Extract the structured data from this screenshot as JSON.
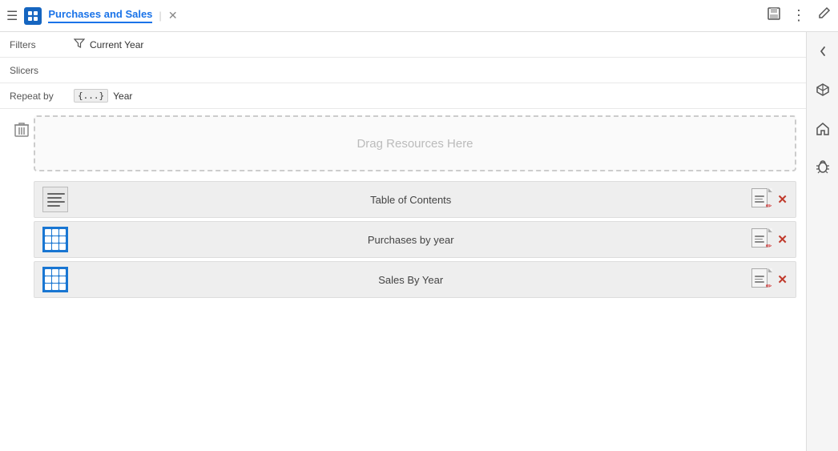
{
  "topbar": {
    "hamburger_label": "☰",
    "app_icon_label": "📊",
    "tab_title": "Purchases and Sales",
    "tab_separator": "|",
    "close_label": "✕",
    "save_icon": "💾",
    "more_icon": "⋮",
    "edit_icon": "✏"
  },
  "config": {
    "filters_label": "Filters",
    "filters_value": "Current Year",
    "slicers_label": "Slicers",
    "repeatby_label": "Repeat by",
    "repeatby_value": "Year"
  },
  "drop_zone": {
    "text": "Drag Resources Here"
  },
  "resources": [
    {
      "id": 1,
      "type": "toc",
      "label": "Table of Contents"
    },
    {
      "id": 2,
      "type": "grid",
      "label": "Purchases by year"
    },
    {
      "id": 3,
      "type": "grid",
      "label": "Sales By Year"
    }
  ],
  "right_sidebar": {
    "icons": [
      "chevron-left",
      "cube",
      "home",
      "bug"
    ]
  }
}
